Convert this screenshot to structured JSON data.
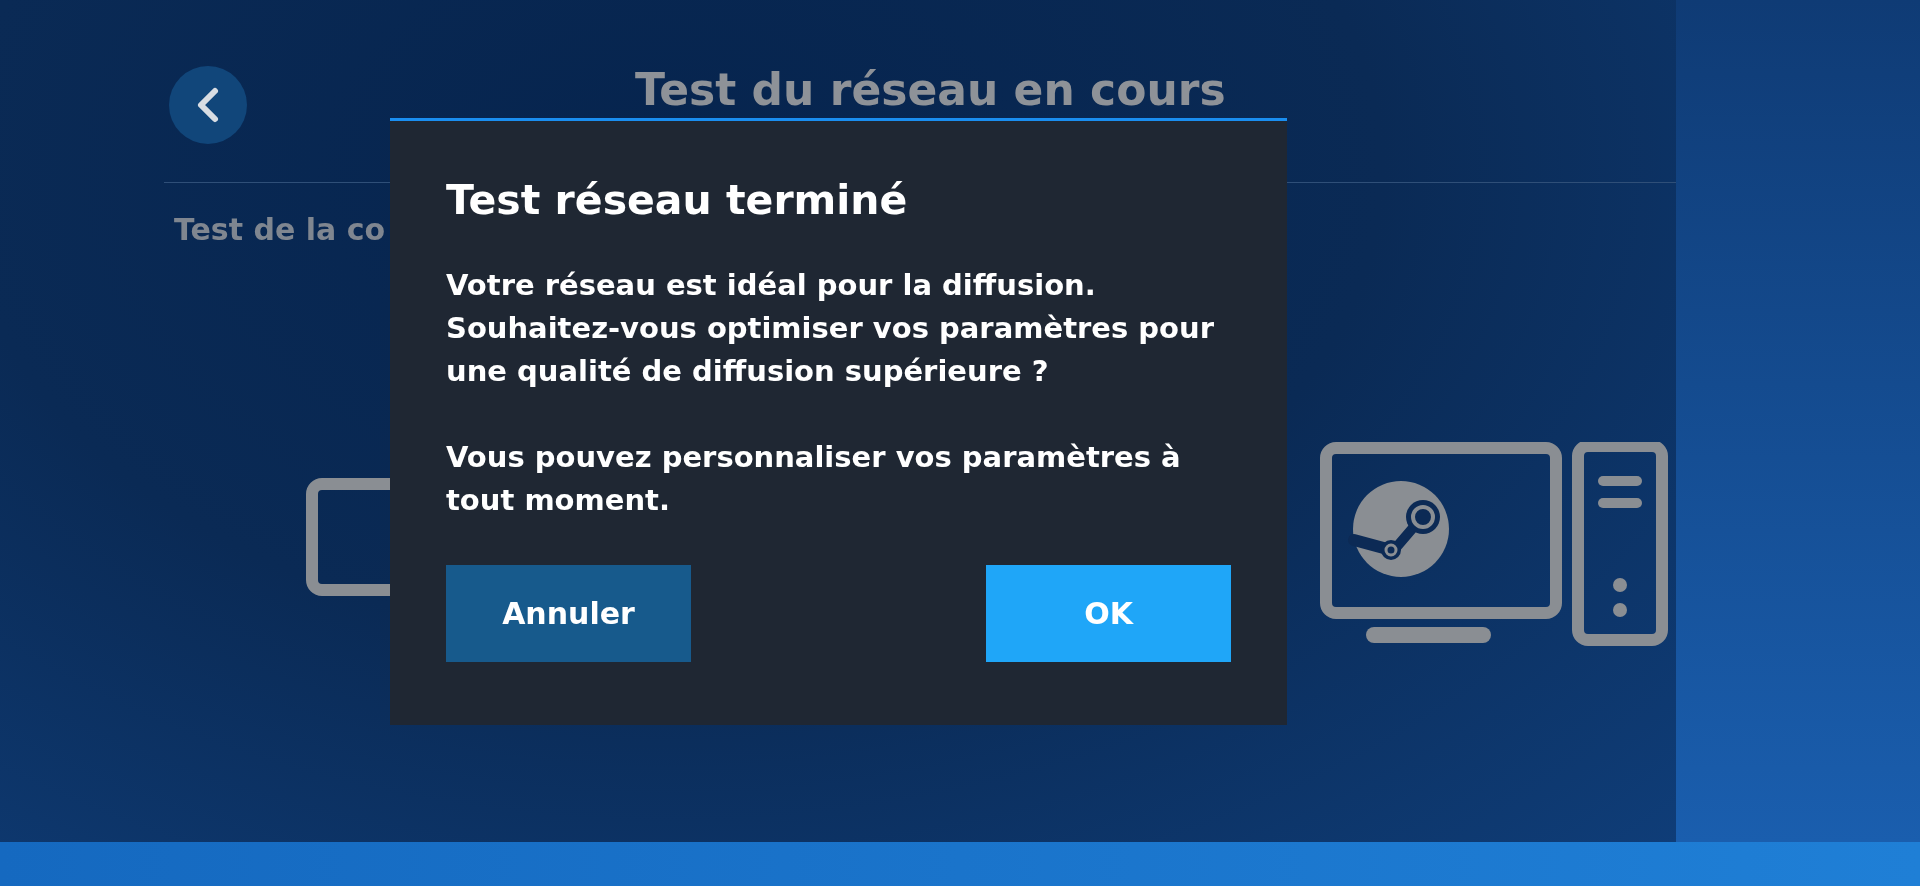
{
  "page": {
    "title": "Test du réseau en cours",
    "subtitle": "Test de la co"
  },
  "dialog": {
    "title": "Test réseau terminé",
    "paragraphs": [
      "Votre réseau est idéal pour la diffusion. Souhaitez-vous optimiser vos paramètres pour une qualité de diffusion supérieure ?",
      "Vous pouvez personnaliser vos paramètres à tout moment."
    ],
    "buttons": [
      {
        "label": "Annuler",
        "kind": "secondary"
      },
      {
        "label": "OK",
        "kind": "primary"
      }
    ]
  }
}
